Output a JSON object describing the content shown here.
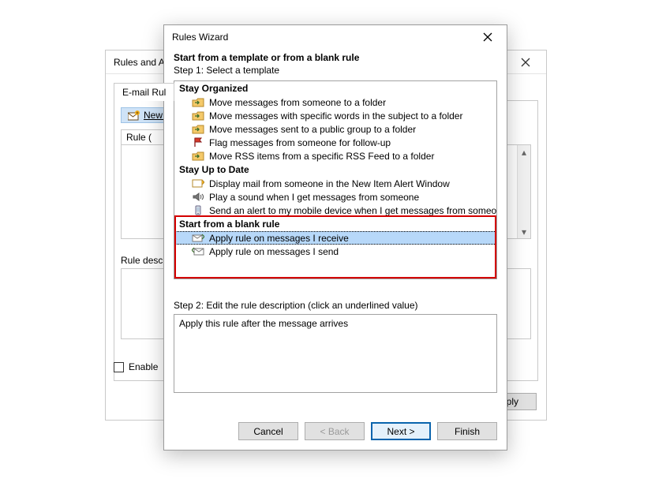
{
  "bg": {
    "title": "Rules and A",
    "tab_label": "E-mail Rul",
    "new_rule": "New R",
    "rule_header": "Rule (",
    "desc_label": "Rule descr",
    "enable_label": "Enable",
    "apply_btn": "Apply"
  },
  "wizard": {
    "title": "Rules Wizard",
    "instr_line1": "Start from a template or from a blank rule",
    "instr_line2": "Step 1: Select a template",
    "groups": [
      {
        "name": "Stay Organized",
        "items": [
          {
            "icon": "folder-move",
            "label": "Move messages from someone to a folder"
          },
          {
            "icon": "folder-move",
            "label": "Move messages with specific words in the subject to a folder"
          },
          {
            "icon": "folder-move",
            "label": "Move messages sent to a public group to a folder"
          },
          {
            "icon": "flag",
            "label": "Flag messages from someone for follow-up"
          },
          {
            "icon": "folder-move",
            "label": "Move RSS items from a specific RSS Feed to a folder"
          }
        ]
      },
      {
        "name": "Stay Up to Date",
        "items": [
          {
            "icon": "alert",
            "label": "Display mail from someone in the New Item Alert Window"
          },
          {
            "icon": "sound",
            "label": "Play a sound when I get messages from someone"
          },
          {
            "icon": "mobile",
            "label": "Send an alert to my mobile device when I get messages from someone"
          }
        ]
      },
      {
        "name": "Start from a blank rule",
        "items": [
          {
            "icon": "mail-in",
            "label": "Apply rule on messages I receive",
            "selected": true
          },
          {
            "icon": "mail-out",
            "label": "Apply rule on messages I send"
          }
        ]
      }
    ],
    "step2_label": "Step 2: Edit the rule description (click an underlined value)",
    "description": "Apply this rule after the message arrives",
    "buttons": {
      "cancel": "Cancel",
      "back": "< Back",
      "next": "Next >",
      "finish": "Finish"
    }
  }
}
